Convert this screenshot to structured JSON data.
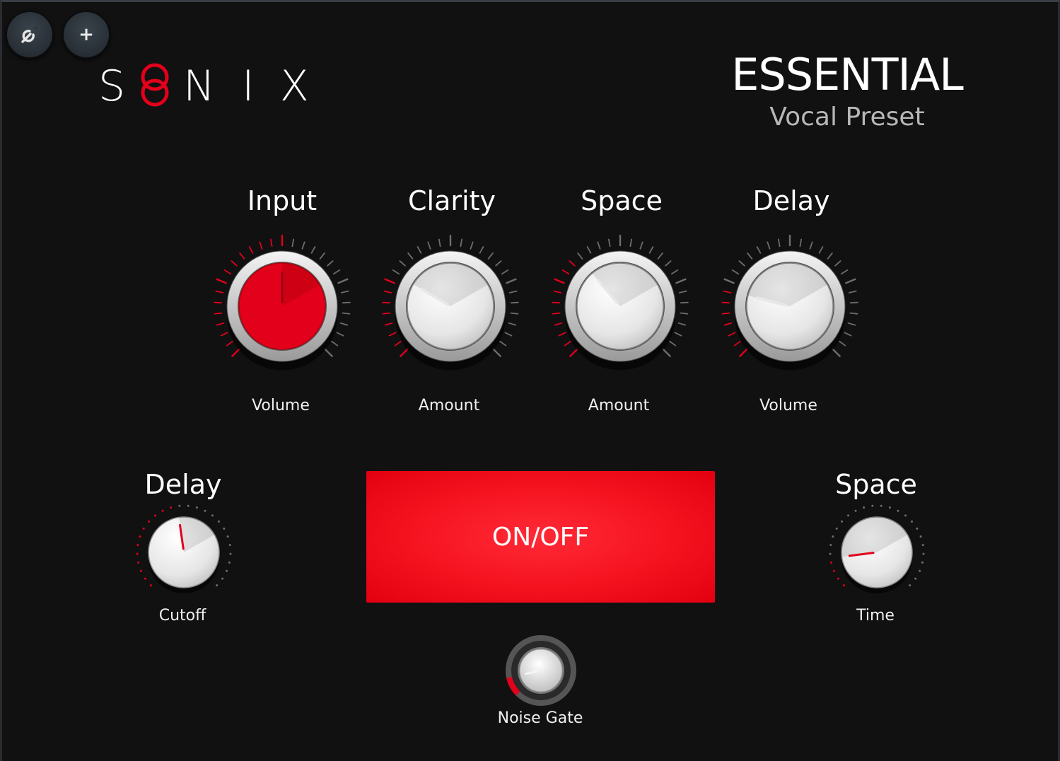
{
  "toolbar": {
    "settings_icon": "wrench-icon",
    "add_icon": "plus-icon",
    "add_label": "+"
  },
  "logo": {
    "letters": [
      "S",
      "N",
      "I",
      "X"
    ],
    "mark_icon": "double-ring-o-icon",
    "accent": "#e3001b"
  },
  "header": {
    "title": "ESSENTIAL",
    "subtitle": "Vocal Preset"
  },
  "knobs": [
    {
      "title": "Input",
      "label": "Volume",
      "value": 0.5,
      "active": true
    },
    {
      "title": "Clarity",
      "label": "Amount",
      "value": 0.28,
      "active": false
    },
    {
      "title": "Space",
      "label": "Amount",
      "value": 0.35,
      "active": false
    },
    {
      "title": "Delay",
      "label": "Volume",
      "value": 0.22,
      "active": false
    }
  ],
  "small_knobs": [
    {
      "title": "Delay",
      "label": "Cutoff",
      "value": 0.47
    },
    {
      "title": "Space",
      "label": "Time",
      "value": 0.14
    }
  ],
  "power_button": {
    "label": "ON/OFF"
  },
  "noise_gate": {
    "label": "Noise Gate",
    "value": 0.12
  },
  "colors": {
    "background": "#111112",
    "accent_red": "#e3001b",
    "tick_gray": "#6e6e6e"
  }
}
